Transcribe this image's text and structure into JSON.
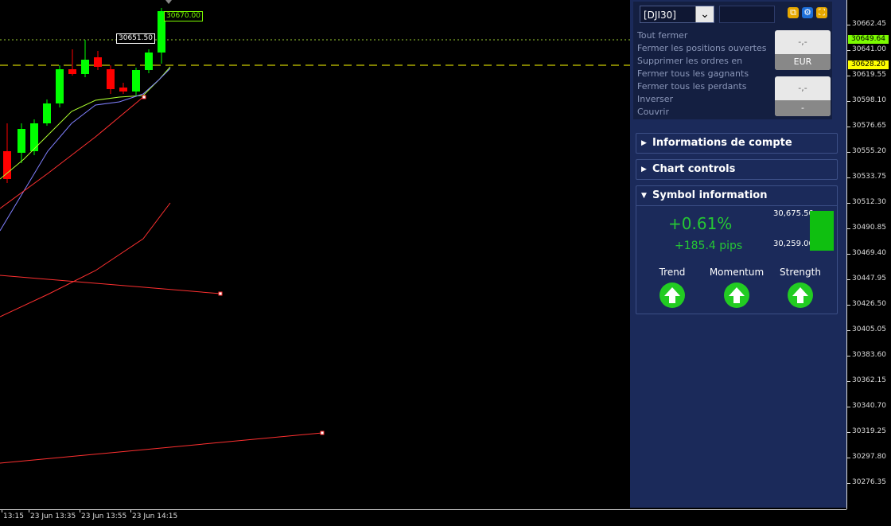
{
  "chart": {
    "price_ticks": [
      "30662.45",
      "30641.00",
      "30619.55",
      "30598.10",
      "30576.65",
      "30555.20",
      "30533.75",
      "30512.30",
      "30490.85",
      "30469.40",
      "30447.95",
      "30426.50",
      "30405.05",
      "30383.60",
      "30362.15",
      "30340.70",
      "30319.25",
      "30297.80",
      "30276.35"
    ],
    "price_tags": [
      {
        "label": "30649.64",
        "bg": "#7cfc00"
      },
      {
        "label": "30628.20",
        "bg": "#ffff00"
      }
    ],
    "time_ticks": [
      "13:15",
      "23 Jun 13:35",
      "23 Jun 13:55",
      "23 Jun 14:15"
    ],
    "float_labels": {
      "last_bid": "30670.00",
      "marker": "30651.50"
    },
    "colors": {
      "bull": "#00ff00",
      "bear": "#ff0000",
      "ask_line": "#ffff00",
      "bid_line": "#9acd32",
      "fast_ma": "#adff2f",
      "slow_ma": "#8080ff",
      "trend": "#ff3030"
    }
  },
  "panel": {
    "symbol": "[DJI30]",
    "quantity": "",
    "menu": [
      "Tout fermer",
      "Fermer les positions ouvertes",
      "Supprimer les ordres en",
      "Fermer tous les gagnants",
      "Fermer tous les perdants",
      "Inverser",
      "Couvrir"
    ],
    "pg_box1": {
      "value": "-,-",
      "unit": "EUR"
    },
    "pg_box2": {
      "value": "-,-",
      "unit": "-"
    },
    "sections": {
      "account": "Informations de compte",
      "chart_controls": "Chart controls",
      "symbol_info": "Symbol information"
    },
    "symbol_info": {
      "change_pct": "+0.61%",
      "change_pips": "+185.4 pips",
      "high": "30,675.50",
      "low": "30,259.00",
      "range_fill": 1.0,
      "indicators": [
        {
          "label": "Trend",
          "direction": "up-arrow-icon"
        },
        {
          "label": "Momentum",
          "direction": "up-arrow-icon"
        },
        {
          "label": "Strength",
          "direction": "up-arrow-icon"
        }
      ]
    }
  }
}
